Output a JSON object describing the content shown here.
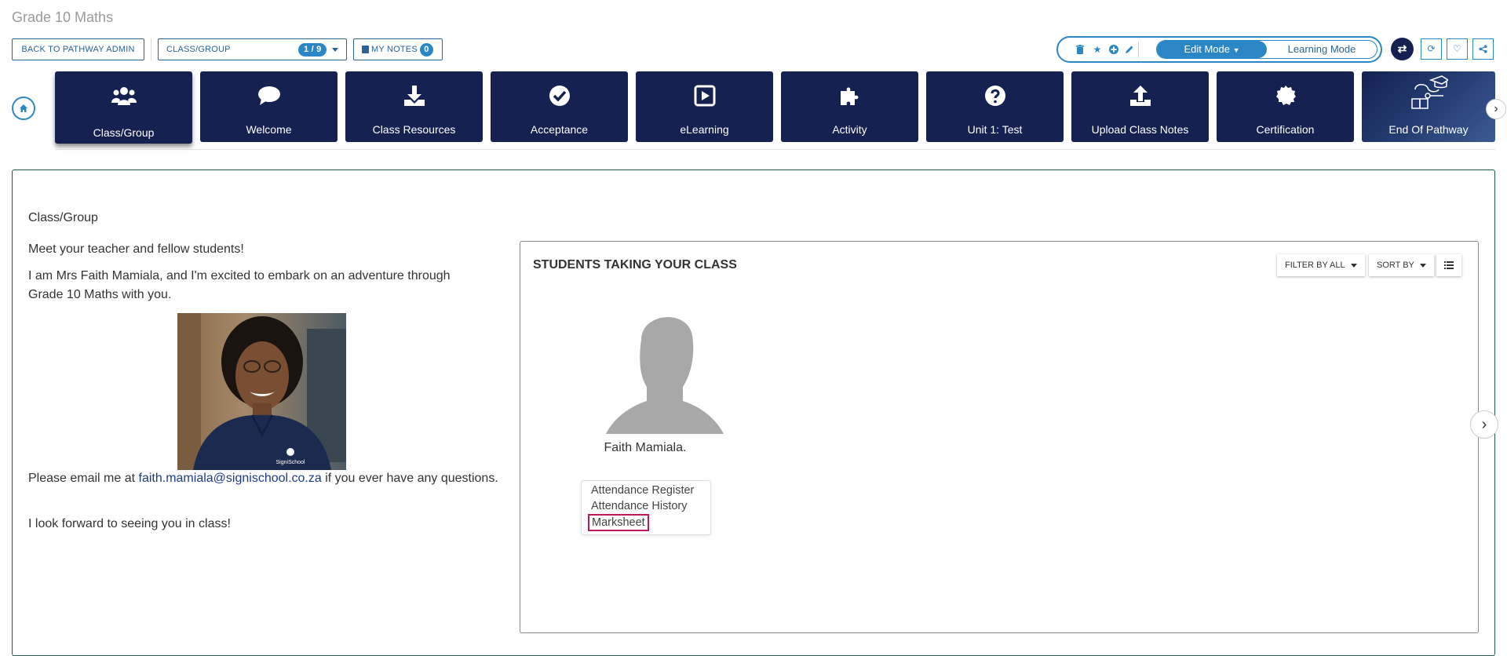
{
  "page": {
    "title": "Grade 10 Maths"
  },
  "toolbar": {
    "back_label": "BACK TO PATHWAY ADMIN",
    "class_select_label": "CLASS/GROUP",
    "class_count": "1 / 9",
    "notes_label": "MY NOTES",
    "notes_count": "0",
    "edit_mode_label": "Edit Mode",
    "learning_mode_label": "Learning Mode"
  },
  "tiles": [
    {
      "label": "Class/Group",
      "icon": "users-icon",
      "active": true
    },
    {
      "label": "Welcome",
      "icon": "comment-icon"
    },
    {
      "label": "Class Resources",
      "icon": "download-icon"
    },
    {
      "label": "Acceptance",
      "icon": "check-circle-icon"
    },
    {
      "label": "eLearning",
      "icon": "play-square-icon"
    },
    {
      "label": "Activity",
      "icon": "puzzle-icon"
    },
    {
      "label": "Unit 1: Test",
      "icon": "question-circle-icon"
    },
    {
      "label": "Upload Class Notes",
      "icon": "upload-icon"
    },
    {
      "label": "Certification",
      "icon": "certificate-icon"
    },
    {
      "label": "End Of Pathway",
      "icon": "graduation-path-icon"
    }
  ],
  "content": {
    "section_title": "Class/Group",
    "intro": "Meet your teacher and fellow students!",
    "para1": "I am Mrs Faith Mamiala, and I'm excited to embark on an adventure through Grade 10 Maths with you.",
    "email_prefix": "Please email me at ",
    "email": "faith.mamiala@signischool.co.za",
    "email_suffix": " if you ever have any questions.",
    "closing": "I look forward to seeing you in class!",
    "photo_logo_text": "SigniSchool"
  },
  "students": {
    "title": "STUDENTS TAKING YOUR CLASS",
    "filter_label": "FILTER BY ALL",
    "sort_label": "SORT BY",
    "items": [
      {
        "name": "Faith Mamiala.",
        "menu": [
          "Attendance Register",
          "Attendance History",
          "Marksheet"
        ]
      }
    ]
  }
}
